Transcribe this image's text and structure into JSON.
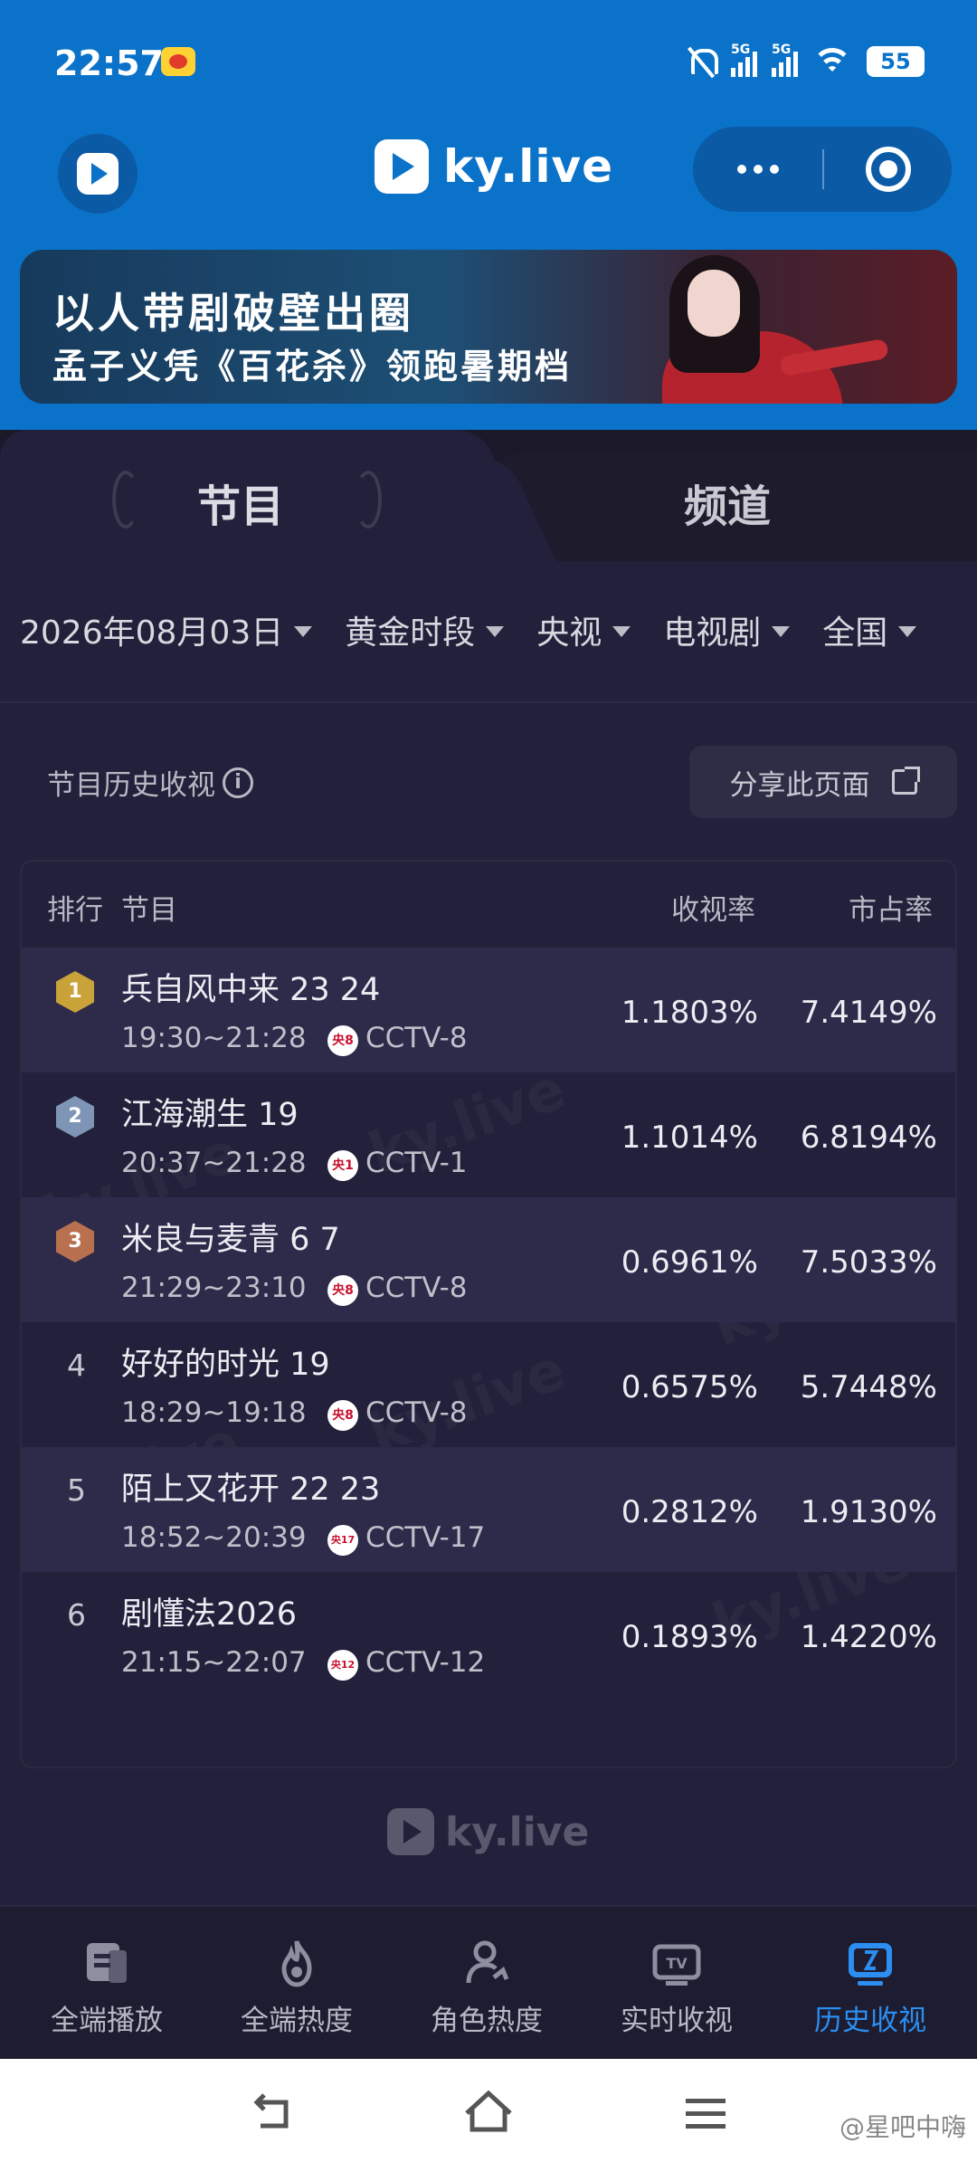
{
  "status_bar": {
    "time": "22:57",
    "signal1_label": "5G",
    "signal2_label": "5G",
    "battery": "55"
  },
  "header": {
    "brand": "ky.live"
  },
  "banner": {
    "line1": "以人带剧破壁出圈",
    "line2": "孟子义凭《百花杀》领跑暑期档"
  },
  "tabs": [
    {
      "label": "节目"
    },
    {
      "label": "频道"
    }
  ],
  "filters": [
    {
      "label": "2026年08月03日"
    },
    {
      "label": "黄金时段"
    },
    {
      "label": "央视"
    },
    {
      "label": "电视剧"
    },
    {
      "label": "全国"
    }
  ],
  "section": {
    "title": "节目历史收视",
    "info": "i",
    "share_label": "分享此页面"
  },
  "table": {
    "headers": {
      "rank": "排行",
      "program": "节目",
      "rating": "收视率",
      "share": "市占率"
    },
    "rows": [
      {
        "rank": "1",
        "name": "兵自风中来 23 24",
        "time": "19:30~21:28",
        "channel_icon": "央8",
        "channel": "CCTV-8",
        "rating": "1.1803%",
        "share": "7.4149%"
      },
      {
        "rank": "2",
        "name": "江海潮生 19",
        "time": "20:37~21:28",
        "channel_icon": "央1",
        "channel": "CCTV-1",
        "rating": "1.1014%",
        "share": "6.8194%"
      },
      {
        "rank": "3",
        "name": "米良与麦青 6 7",
        "time": "21:29~23:10",
        "channel_icon": "央8",
        "channel": "CCTV-8",
        "rating": "0.6961%",
        "share": "7.5033%"
      },
      {
        "rank": "4",
        "name": "好好的时光 19",
        "time": "18:29~19:18",
        "channel_icon": "央8",
        "channel": "CCTV-8",
        "rating": "0.6575%",
        "share": "5.7448%"
      },
      {
        "rank": "5",
        "name": "陌上又花开 22 23",
        "time": "18:52~20:39",
        "channel_icon": "央17",
        "channel": "CCTV-17",
        "rating": "0.2812%",
        "share": "1.9130%"
      },
      {
        "rank": "6",
        "name": "剧懂法2026",
        "time": "21:15~22:07",
        "channel_icon": "央12",
        "channel": "CCTV-12",
        "rating": "0.1893%",
        "share": "1.4220%"
      }
    ],
    "badge_colors": [
      "#c9a23a",
      "#7e95b5",
      "#b8704f"
    ]
  },
  "footer": {
    "logo_text": "ky.live"
  },
  "bottom_nav": [
    {
      "label": "全端播放",
      "icon": "media-icon"
    },
    {
      "label": "全端热度",
      "icon": "flame-icon"
    },
    {
      "label": "角色热度",
      "icon": "person-icon"
    },
    {
      "label": "实时收视",
      "icon": "tv-icon"
    },
    {
      "label": "历史收视",
      "icon": "history-icon",
      "active": true
    }
  ],
  "watermark": "@星吧中嗨",
  "colors": {
    "status_blue": "#0a72c9",
    "panel_bg": "#22203a",
    "row_highlight": "#2d2a4a",
    "nav_active": "#2b8ef0"
  }
}
